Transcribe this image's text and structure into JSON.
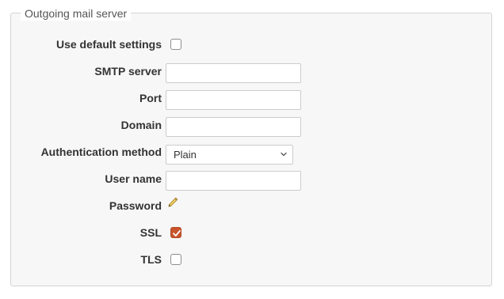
{
  "fieldset": {
    "legend": "Outgoing mail server"
  },
  "form": {
    "use_default_settings": {
      "label": "Use default settings",
      "checked": false
    },
    "smtp_server": {
      "label": "SMTP server",
      "value": ""
    },
    "port": {
      "label": "Port",
      "value": ""
    },
    "domain": {
      "label": "Domain",
      "value": ""
    },
    "authentication_method": {
      "label": "Authentication method",
      "selected": "Plain"
    },
    "user_name": {
      "label": "User name",
      "value": ""
    },
    "password": {
      "label": "Password",
      "icon": "pencil-icon"
    },
    "ssl": {
      "label": "SSL",
      "checked": true
    },
    "tls": {
      "label": "TLS",
      "checked": false
    }
  },
  "colors": {
    "accent": "#c8552b",
    "fieldset_bg": "#f7f7f7",
    "border": "#d4d4d4"
  }
}
